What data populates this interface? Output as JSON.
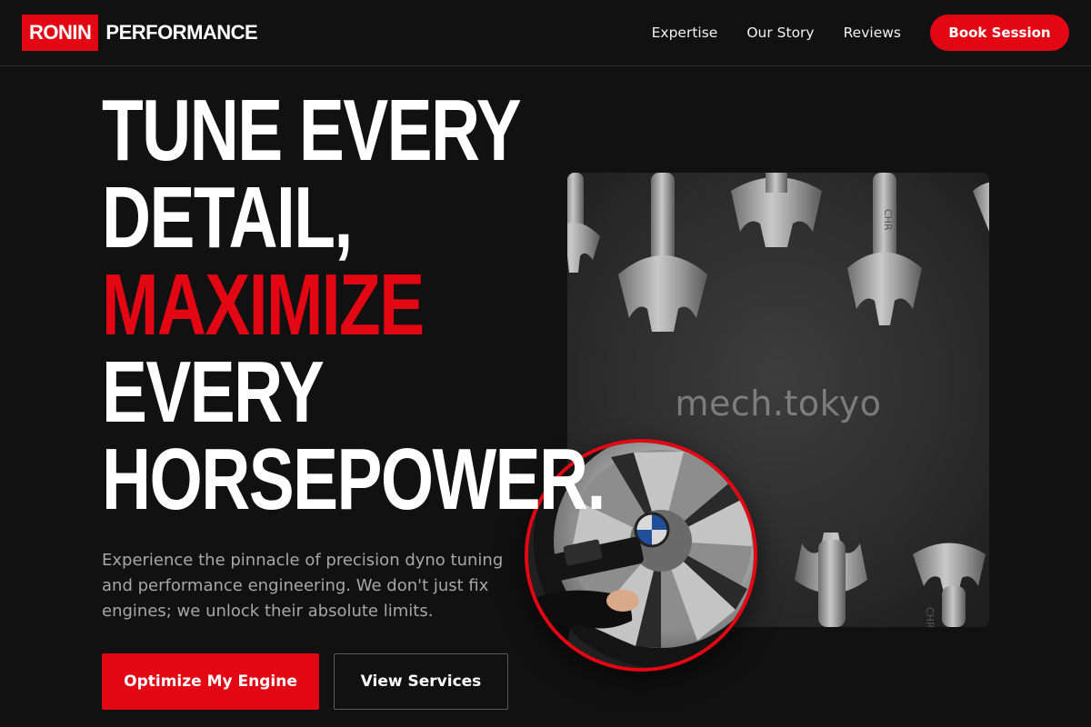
{
  "colors": {
    "background": "#111111",
    "accent": "#e30613",
    "text": "#ffffff",
    "muted_text": "#a7a7a7",
    "border": "#2a2a2a"
  },
  "brand": {
    "mark": "RONIN",
    "name": "PERFORMANCE"
  },
  "nav": {
    "items": [
      {
        "label": "Expertise"
      },
      {
        "label": "Our Story"
      },
      {
        "label": "Reviews"
      }
    ],
    "cta_label": "Book Session"
  },
  "hero": {
    "headline": {
      "line1": "TUNE EVERY",
      "line2": "DETAIL,",
      "line3_accent": "MAXIMIZE",
      "line4": "EVERY",
      "line5": "HORSEPOWER."
    },
    "lede": "Experience the pinnacle of precision dyno tuning and performance engineering. We don't just fix engines; we unlock their absolute limits.",
    "primary_cta": "Optimize My Engine",
    "secondary_cta": "View Services",
    "main_image": {
      "subject": "wrenches-on-dark-fabric",
      "watermark": "mech.tokyo"
    },
    "inset_image": {
      "subject": "impact-wrench-on-car-wheel"
    }
  }
}
